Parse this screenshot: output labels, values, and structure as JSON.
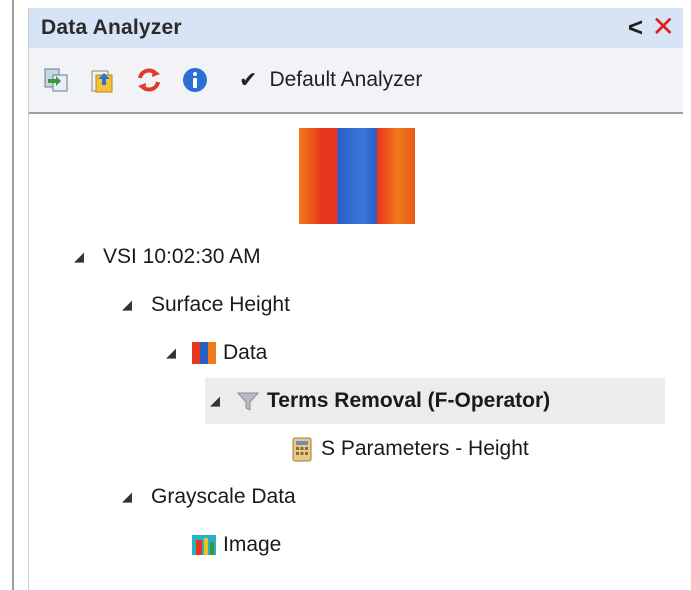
{
  "panel": {
    "title": "Data Analyzer",
    "collapse_glyph": "<",
    "close_glyph": "✕"
  },
  "toolbar": {
    "buttons": [
      {
        "icon": "export-icon"
      },
      {
        "icon": "open-folder-icon"
      },
      {
        "icon": "refresh-icon"
      },
      {
        "icon": "info-icon"
      }
    ],
    "default_check": "✔",
    "default_label": "Default Analyzer"
  },
  "tree": {
    "root": {
      "label": "VSI 10:02:30 AM",
      "expander": "◢"
    },
    "surface": {
      "label": "Surface Height",
      "expander": "◢"
    },
    "data": {
      "label": "Data",
      "expander": "◢"
    },
    "terms": {
      "label": "Terms Removal (F-Operator)",
      "expander": "◢"
    },
    "sparams": {
      "label": "S Parameters - Height"
    },
    "grayscale": {
      "label": "Grayscale Data",
      "expander": "◢"
    },
    "image": {
      "label": "Image"
    }
  },
  "colors": {
    "titlebar": "#d6e4f5",
    "close": "#e02020",
    "thumb_red": "#e8361c",
    "thumb_orange": "#f07a1a",
    "thumb_blue": "#3b78d8",
    "selected_row": "#ececec"
  }
}
